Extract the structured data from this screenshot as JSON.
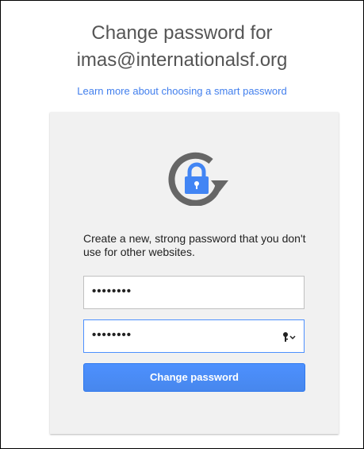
{
  "header": {
    "title_line1": "Change password for",
    "title_line2": "imas@internationalsf.org"
  },
  "help_link": {
    "text": "Learn more about choosing a smart password"
  },
  "card": {
    "icon": "refresh-lock-icon",
    "instructions": "Create a new, strong password that you don't use for other websites.",
    "new_password": {
      "value_masked": "••••••••"
    },
    "confirm_password": {
      "value_masked": "••••••••",
      "trailing_icon": "keychain-key-icon"
    },
    "submit_label": "Change password"
  },
  "colors": {
    "accent": "#4d90fe",
    "link": "#427fed",
    "icon_gray": "#666666",
    "lock_blue": "#4285f4",
    "card_bg": "#f1f1f1"
  }
}
